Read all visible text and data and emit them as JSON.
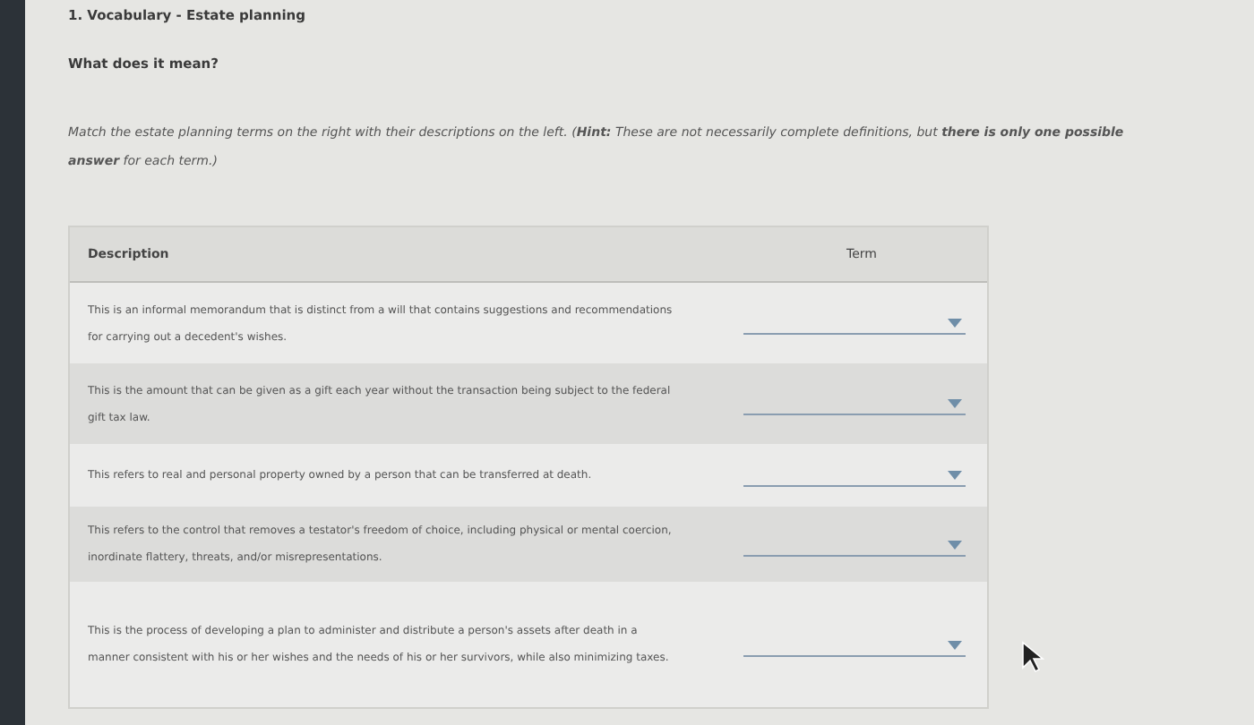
{
  "question": {
    "title": "1. Vocabulary - Estate planning",
    "subtitle": "What does it mean?",
    "instructions": "Match the estate planning terms on the right with their descriptions on the left. (**Hint:** These are not necessarily complete definitions, but **there is only one possible answer** for each term.)"
  },
  "table": {
    "columns": [
      "Description",
      "Term"
    ],
    "rows": [
      {
        "description": "This is an informal memorandum that is distinct from a will that contains suggestions and recommendations for carrying out a decedent's wishes."
      },
      {
        "description": "This is the amount that can be given as a gift each year without the transaction being subject to the federal gift tax law."
      },
      {
        "description": "This refers to real and personal property owned by a person that can be transferred at death."
      },
      {
        "description": "This refers to the control that removes a testator's freedom of choice, including physical or mental coercion, inordinate flattery, threats, and/or misrepresentations."
      },
      {
        "description": "This is the process of developing a plan to administer and distribute a person's assets after death in a manner consistent with his or her wishes and the needs of his or her survivors, while also minimizing taxes."
      }
    ]
  }
}
